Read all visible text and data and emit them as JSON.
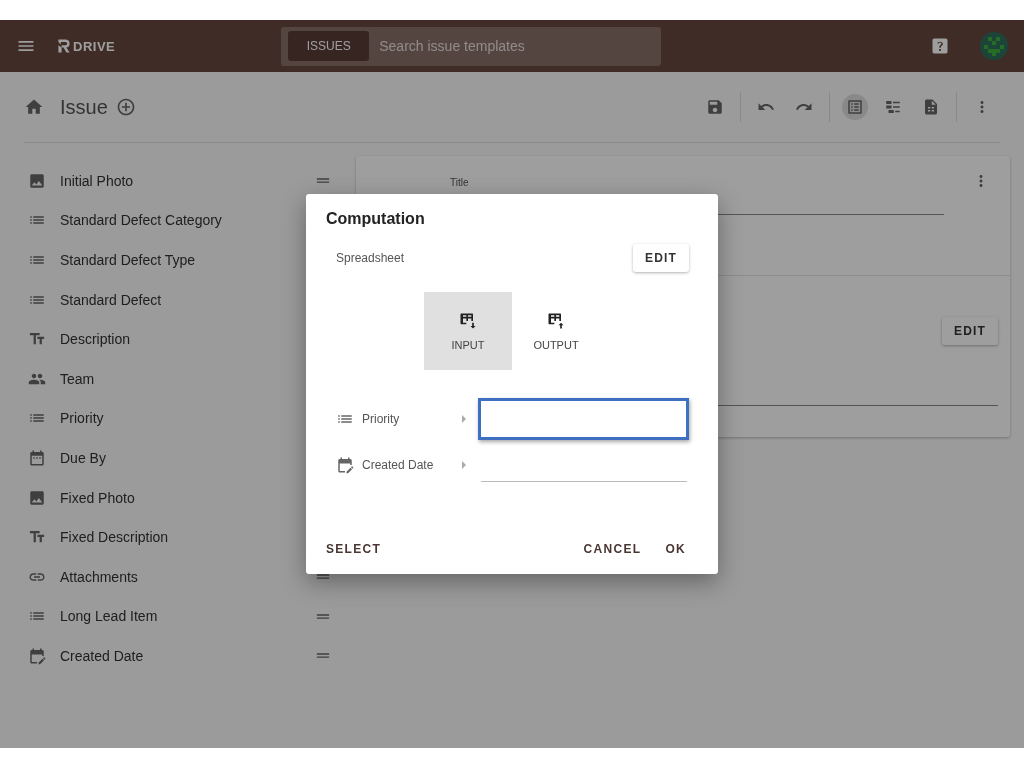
{
  "app_bar": {
    "brand": "DRIVE",
    "search_scope": "ISSUES",
    "search": {
      "placeholder": "Search issue templates"
    }
  },
  "page": {
    "title": "Issue"
  },
  "toolbar": [
    {
      "kind": "save"
    },
    {
      "kind": "divider"
    },
    {
      "kind": "undo"
    },
    {
      "kind": "redo"
    },
    {
      "kind": "divider"
    },
    {
      "kind": "form",
      "selected": true
    },
    {
      "kind": "outline",
      "selected": false
    },
    {
      "kind": "document",
      "selected": false
    },
    {
      "kind": "divider"
    },
    {
      "kind": "more"
    }
  ],
  "fields": [
    {
      "label": "Initial Photo",
      "kind": "photo",
      "drag_handle": true
    },
    {
      "label": "Standard Defect Category",
      "kind": "list",
      "drag_handle": false
    },
    {
      "label": "Standard Defect Type",
      "kind": "list",
      "drag_handle": false
    },
    {
      "label": "Standard Defect",
      "kind": "list",
      "drag_handle": false
    },
    {
      "label": "Description",
      "kind": "text",
      "drag_handle": false
    },
    {
      "label": "Team",
      "kind": "team",
      "drag_handle": false
    },
    {
      "label": "Priority",
      "kind": "list",
      "drag_handle": false
    },
    {
      "label": "Due By",
      "kind": "date",
      "drag_handle": false
    },
    {
      "label": "Fixed Photo",
      "kind": "photo",
      "drag_handle": false
    },
    {
      "label": "Fixed Description",
      "kind": "text",
      "drag_handle": false
    },
    {
      "label": "Attachments",
      "kind": "link",
      "drag_handle": true
    },
    {
      "label": "Long Lead Item",
      "kind": "list",
      "drag_handle": true
    },
    {
      "label": "Created Date",
      "kind": "created_date",
      "drag_handle": true
    }
  ],
  "detail_card": {
    "title_label": "Title",
    "edit_button": "EDIT"
  },
  "dialog": {
    "title": "Computation",
    "source_label": "Spreadsheet",
    "edit_button": "EDIT",
    "tabs": [
      {
        "label": "INPUT",
        "kind": "input",
        "selected": true
      },
      {
        "label": "OUTPUT",
        "kind": "output",
        "selected": false
      }
    ],
    "mappings": [
      {
        "label": "Priority",
        "kind": "list",
        "highlighted": true
      },
      {
        "label": "Created Date",
        "kind": "created_date",
        "highlighted": false
      }
    ],
    "actions_left": [
      "SELECT"
    ],
    "actions_right": [
      "CANCEL",
      "OK"
    ]
  }
}
